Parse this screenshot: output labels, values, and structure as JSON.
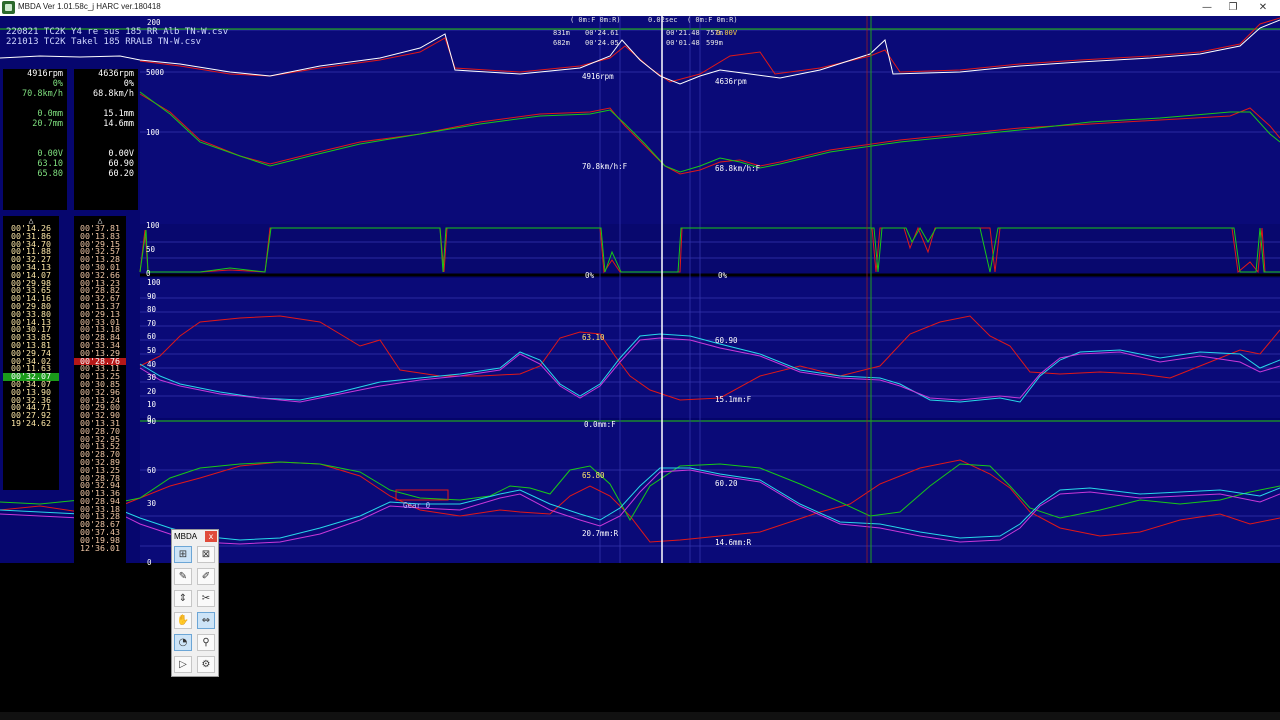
{
  "window": {
    "title": "MBDA Ver 1.01.58c_j HARC ver.180418",
    "minimize_glyph": "—",
    "maximize_glyph": "❐",
    "close_glyph": "✕"
  },
  "files": [
    "220821 TC2K Y4 re sus 185 RR Alb TN-W.csv",
    "221013 TC2K Takel 185 RRALB TN-W.csv"
  ],
  "hud": {
    "header_left": "(    0m:F   0m:R)",
    "header_dt": "0.02sec",
    "header_right": "(    0m:F   0m:R)",
    "dist_f": "831m",
    "dist_r": "682m",
    "time_f": "00'24.61",
    "time_r": "00'24.05",
    "time_f2": "00'21.48",
    "time_r2": "00'01.48",
    "dist_f2": "757m",
    "dist_r2": "599m",
    "volt": "0.00V"
  },
  "scales": {
    "rpm_top": "200",
    "rpm_5000": "5000",
    "speed_100": "100",
    "throttle_100": "100",
    "throttle_50": "50",
    "throttle_0": "0",
    "susp_ticks": [
      "100",
      "90",
      "80",
      "70",
      "60",
      "50",
      "40",
      "30",
      "20",
      "10",
      "0"
    ],
    "lower_ticks": [
      "90",
      "60",
      "30",
      "0"
    ]
  },
  "cursor_labels": {
    "rpm_f": "4916rpm",
    "rpm_r": "4636rpm",
    "speed_f": "70.8km/h:F",
    "speed_r": "68.8km/h:F",
    "thr_f": "0%",
    "thr_r": "0%",
    "s1_f": "63.10",
    "s1_r": "60.90",
    "s2_r": "15.1mm:F",
    "s3_f": "0.0mm:F",
    "s4_f": "65.80",
    "s4_r": "60.20",
    "s5_f": "20.7mm:R",
    "s5_r": "14.6mm:R",
    "gear": "Gear 0"
  },
  "panelA": {
    "rpm": "4916rpm",
    "pct": "0%",
    "speed": "70.8km/h",
    "mm1": "0.0mm",
    "mm2": "20.7mm",
    "volt": "0.00V",
    "v1": "63.10",
    "v2": "65.80"
  },
  "panelB": {
    "rpm": "4636rpm",
    "pct": "0%",
    "speed": "68.8km/h",
    "mm1": "15.1mm",
    "mm2": "14.6mm",
    "volt": "0.00V",
    "v1": "60.90",
    "v2": "60.20"
  },
  "laps_marker": "△",
  "lapsA": [
    "00'14.26",
    "00'31.86",
    "00'34.70",
    "00'11.88",
    "00'32.27",
    "00'34.13",
    "00'14.07",
    "00'29.98",
    "00'33.65",
    "00'14.16",
    "00'29.80",
    "00'33.80",
    "00'14.13",
    "00'30.17",
    "00'33.85",
    "00'13.81",
    "00'29.74",
    "00'34.02",
    "00'11.63",
    "00'32.07",
    "00'34.07",
    "00'13.90",
    "00'32.36",
    "00'44.71",
    "00'27.92",
    "19'24.62"
  ],
  "lapsA_highlight": 19,
  "lapsB": [
    "00'37.81",
    "00'13.83",
    "00'29.15",
    "00'32.57",
    "00'13.28",
    "00'30.01",
    "00'32.66",
    "00'13.23",
    "00'28.82",
    "00'32.67",
    "00'13.37",
    "00'29.13",
    "00'33.01",
    "00'13.18",
    "00'28.84",
    "00'33.34",
    "00'13.29",
    "00'28.76",
    "00'33.11",
    "00'13.25",
    "00'30.85",
    "00'32.96",
    "00'13.24",
    "00'29.00",
    "00'32.90",
    "00'13.31",
    "00'28.70",
    "00'32.95",
    "00'13.52",
    "00'28.70",
    "00'32.89",
    "00'13.25",
    "00'28.78",
    "00'32.94",
    "00'13.36",
    "00'28.94",
    "00'33.18",
    "00'13.28",
    "00'28.67",
    "00'37.43",
    "00'19.98",
    "12'36.01"
  ],
  "lapsB_highlight": 17,
  "palette": {
    "title": "MBDA",
    "close": "x",
    "tools": [
      {
        "name": "graph-select-tool-icon",
        "glyph": "⊞"
      },
      {
        "name": "graph-overlay-tool-icon",
        "glyph": "⊠"
      },
      {
        "name": "marker-yellow-tool-icon",
        "glyph": "✎"
      },
      {
        "name": "marker-orange-tool-icon",
        "glyph": "✐"
      },
      {
        "name": "move-vertical-tool-icon",
        "glyph": "⇕"
      },
      {
        "name": "crop-tool-icon",
        "glyph": "✂"
      },
      {
        "name": "hand-pan-tool-icon",
        "glyph": "✋"
      },
      {
        "name": "horizontal-zoom-tool-icon",
        "glyph": "⇔"
      },
      {
        "name": "gauge-tool-icon",
        "glyph": "◔"
      },
      {
        "name": "magnifier-tool-icon",
        "glyph": "⚲"
      },
      {
        "name": "play-tool-icon",
        "glyph": "▷"
      },
      {
        "name": "settings-tool-icon",
        "glyph": "⚙"
      }
    ]
  },
  "colors": {
    "plot_bg": "#0a0a7a",
    "red_trace": "#e01818",
    "green_trace": "#18c818",
    "cyan_trace": "#28d8e8",
    "magenta_trace": "#c838d8",
    "white_trace": "#ffffff",
    "cursor_line": "#ffffff",
    "green_cursor": "#1fa01f"
  }
}
